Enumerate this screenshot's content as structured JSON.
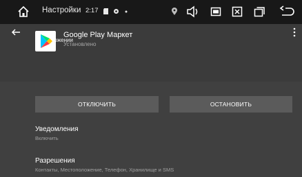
{
  "status_bar": {
    "app_title": "Настройки",
    "time": "2:17",
    "icons": [
      "home-icon",
      "sd-card-icon",
      "settings-gear-icon",
      "dot-icon",
      "location-icon",
      "volume-icon",
      "screenshot-icon",
      "close-box-icon",
      "recent-apps-icon",
      "back-icon"
    ]
  },
  "app_bar": {
    "title": "О приложении"
  },
  "app": {
    "name": "Google Play Маркет",
    "status": "Установлено",
    "icon": "google-play-icon"
  },
  "actions": {
    "disable_label": "ОТКЛЮЧИТЬ",
    "stop_label": "ОСТАНОВИТЬ"
  },
  "settings": [
    {
      "title": "Уведомления",
      "subtitle": "Включить"
    },
    {
      "title": "Разрешения",
      "subtitle": "Контакты, Местоположение, Телефон, Хранилище и SMS"
    }
  ],
  "colors": {
    "status_bar_bg": "#181818",
    "app_bar_bg": "#3b3b3b",
    "content_bg": "#404040",
    "button_bg": "#5b5b5b"
  }
}
